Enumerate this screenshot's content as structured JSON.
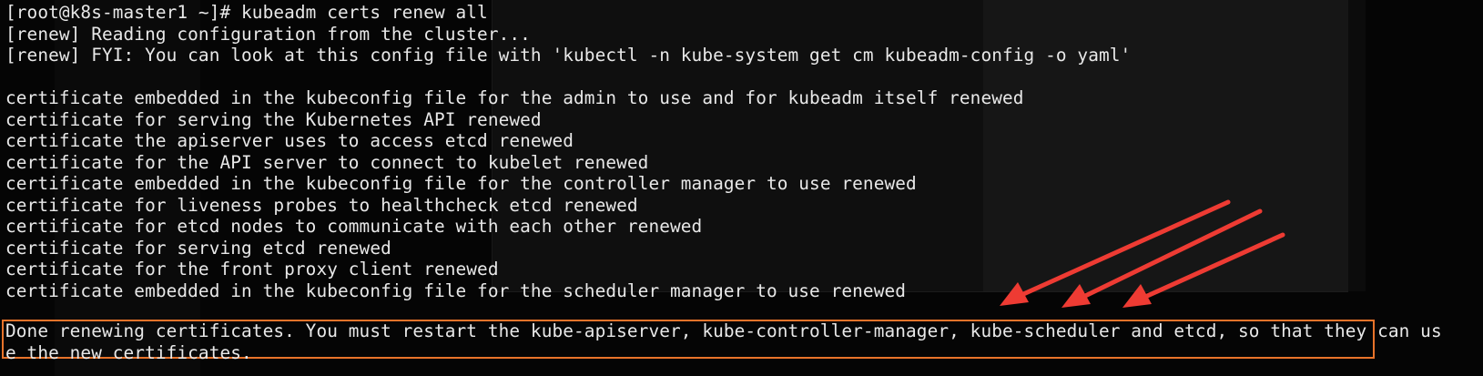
{
  "terminal": {
    "lines": [
      "[root@k8s-master1 ~]# kubeadm certs renew all",
      "[renew] Reading configuration from the cluster...",
      "[renew] FYI: You can look at this config file with 'kubectl -n kube-system get cm kubeadm-config -o yaml'",
      "",
      "certificate embedded in the kubeconfig file for the admin to use and for kubeadm itself renewed",
      "certificate for serving the Kubernetes API renewed",
      "certificate the apiserver uses to access etcd renewed",
      "certificate for the API server to connect to kubelet renewed",
      "certificate embedded in the kubeconfig file for the controller manager to use renewed",
      "certificate for liveness probes to healthcheck etcd renewed",
      "certificate for etcd nodes to communicate with each other renewed",
      "certificate for serving etcd renewed",
      "certificate for the front proxy client renewed",
      "certificate embedded in the kubeconfig file for the scheduler manager to use renewed"
    ],
    "highlighted_lines": [
      "Done renewing certificates. You must restart the kube-apiserver, kube-controller-manager, kube-scheduler and etcd, so that they can us",
      "e the new certificates."
    ]
  },
  "colors": {
    "background": "#050505",
    "text": "#e8e8e8",
    "highlight_border": "#e8732a",
    "arrow": "#ee3b33"
  },
  "annotations": {
    "arrow_count": 3,
    "icon": "red-arrow-icon"
  }
}
